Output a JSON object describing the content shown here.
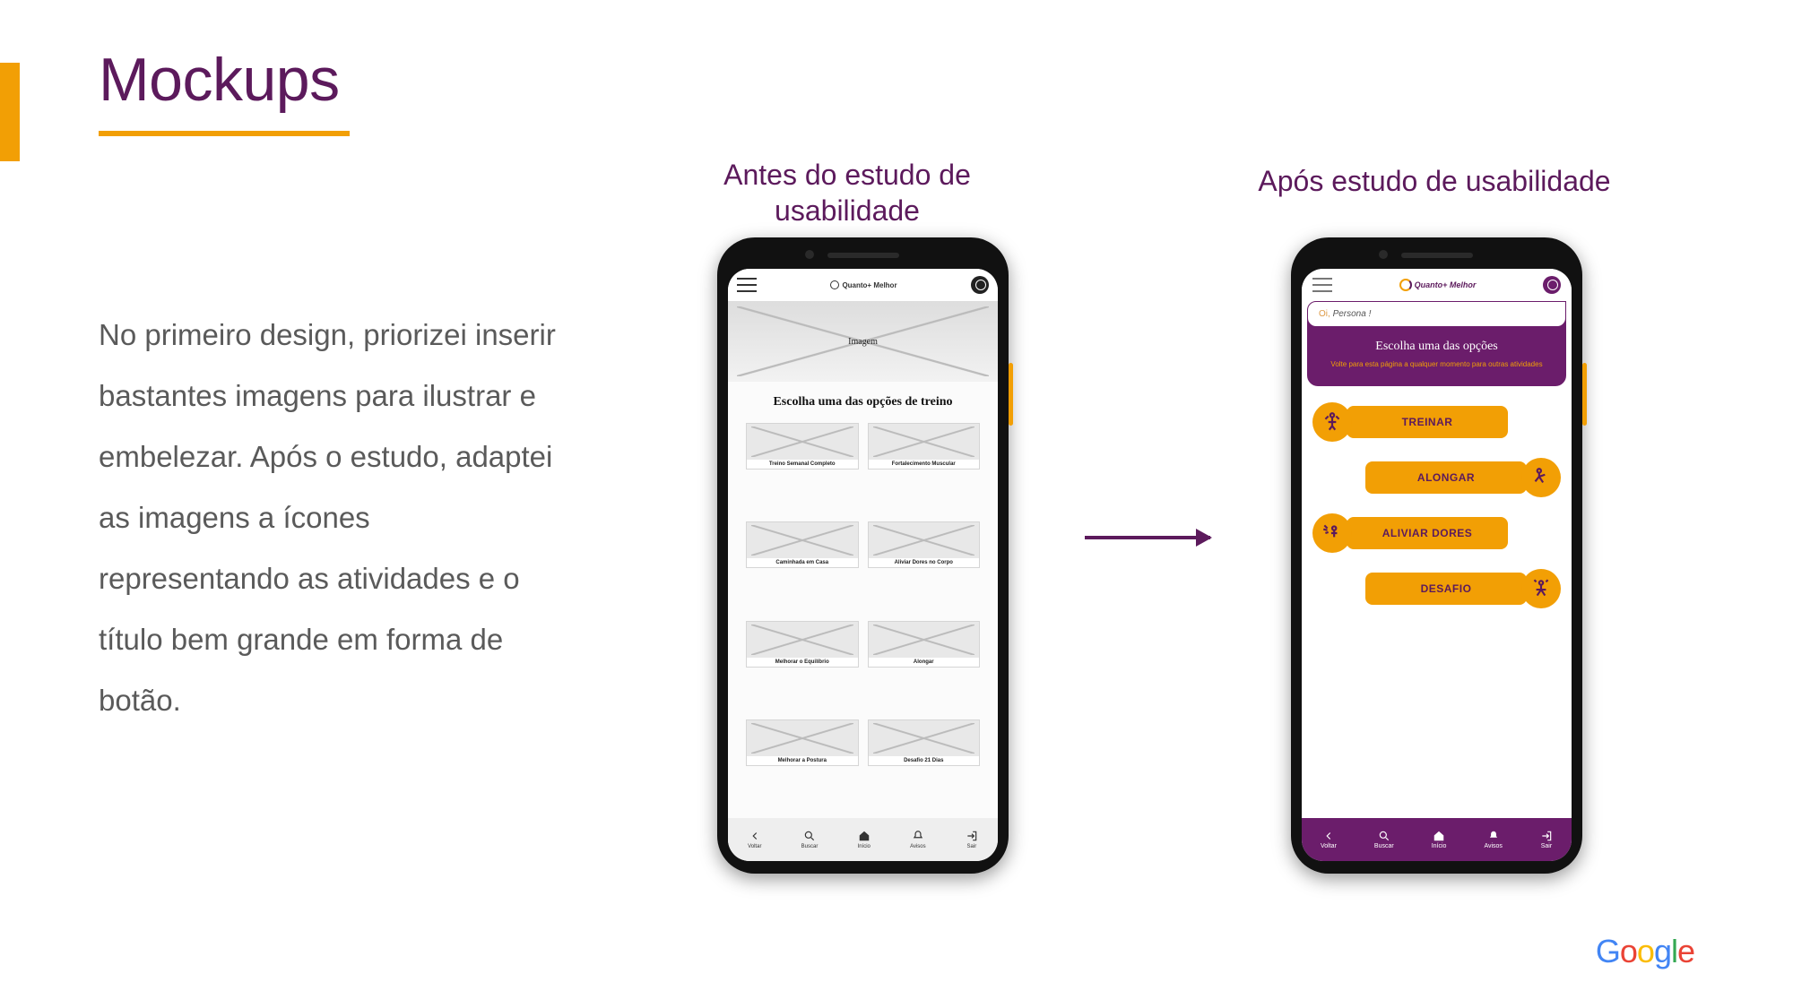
{
  "title": "Mockups",
  "body": "No primeiro design, priorizei inserir bastantes imagens para ilustrar e embelezar. Após o estudo, adaptei as imagens a ícones representando as atividades e o título bem grande em forma de botão.",
  "caption_before": "Antes do estudo de usabilidade",
  "caption_after": "Após estudo de usabilidade",
  "before": {
    "app_name": "Quanto+ Melhor",
    "hero_label": "Imagem",
    "heading": "Escolha uma das opções de treino",
    "cards": [
      "Treino Semanal Completo",
      "Fortalecimento Muscular",
      "Caminhada em Casa",
      "Aliviar Dores no Corpo",
      "Melhorar o Equilíbrio",
      "Alongar",
      "Melhorar a Postura",
      "Desafio 21 Dias"
    ],
    "nav": [
      "Voltar",
      "Buscar",
      "Início",
      "Avisos",
      "Sair"
    ]
  },
  "after": {
    "app_name": "Quanto+ Melhor",
    "greet_hi": "Oi, ",
    "greet_name": "Persona !",
    "panel_h": "Escolha uma das opções",
    "panel_sub": "Volte para esta página a qualquer momento para outras atividades",
    "buttons": [
      "TREINAR",
      "ALONGAR",
      "ALIVIAR DORES",
      "DESAFIO"
    ],
    "nav": [
      "Voltar",
      "Buscar",
      "Início",
      "Avisos",
      "Sair"
    ]
  },
  "footer_logo": "Google"
}
